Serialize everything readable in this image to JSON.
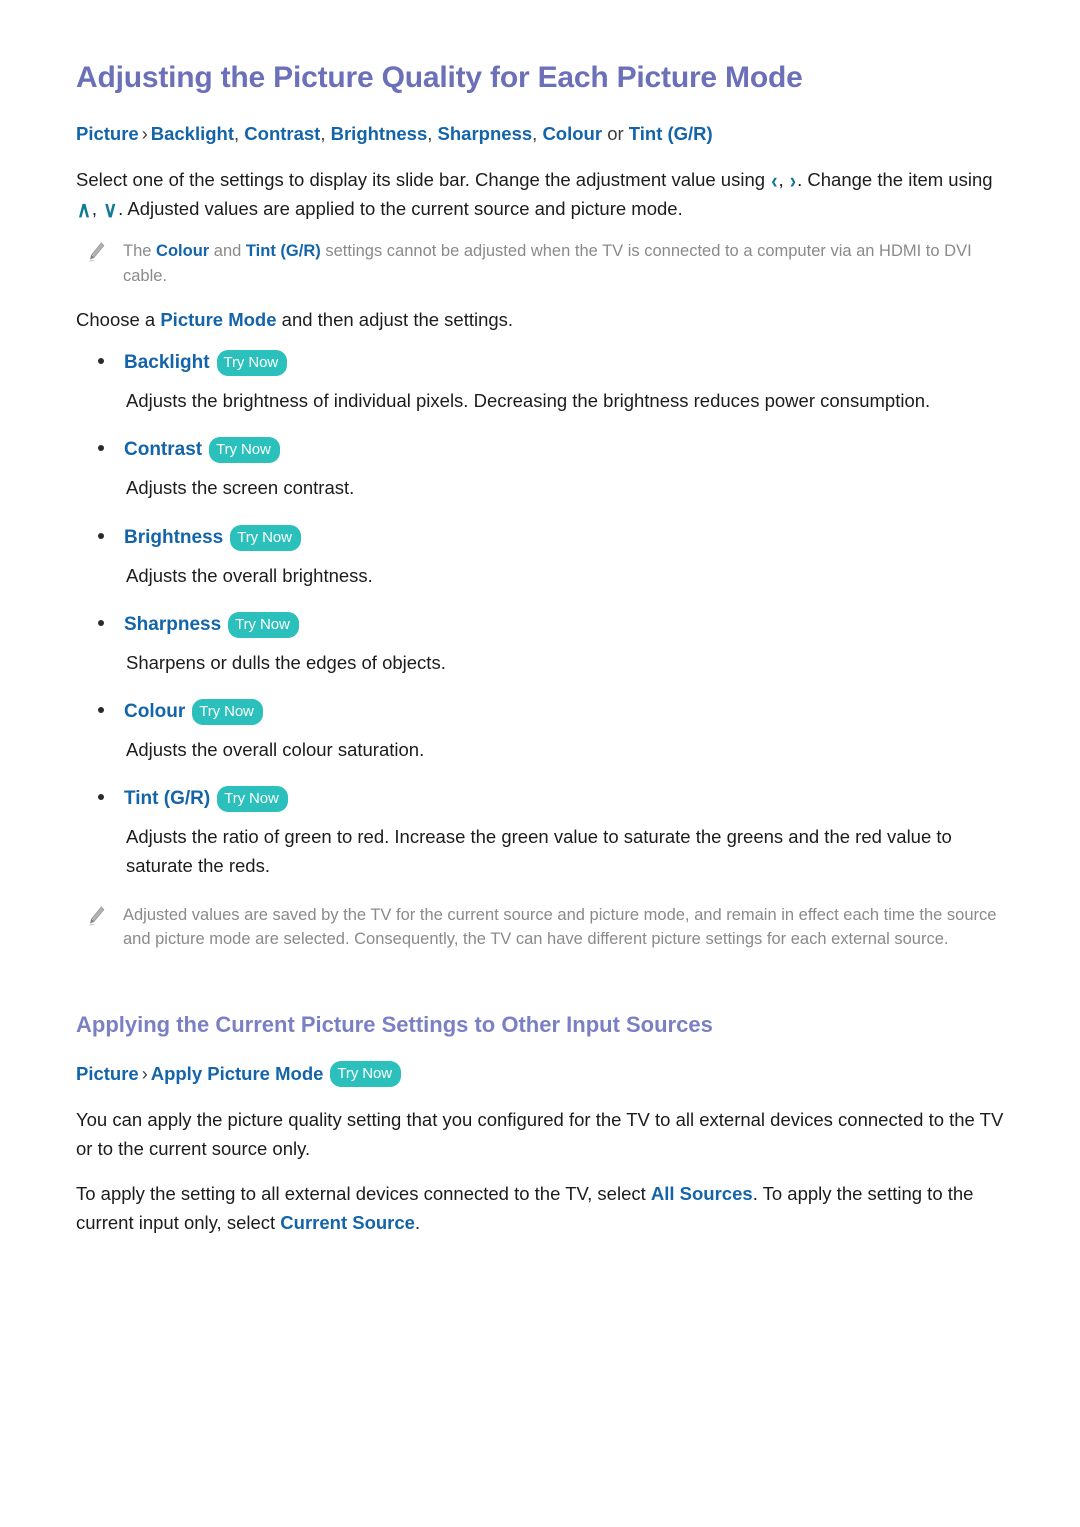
{
  "document": {
    "title": "Adjusting the Picture Quality for Each Picture Mode",
    "breadcrumb_1": {
      "root": "Picture",
      "separator": "›",
      "items": [
        "Backlight",
        "Contrast",
        "Brightness",
        "Sharpness",
        "Colour"
      ],
      "conjunction": "or",
      "last_item": "Tint (G/R)",
      "comma": ", "
    },
    "intro_paragraph": {
      "part_1": "Select one of the settings to display its slide bar. Change the adjustment value using ",
      "icon_left": "‹",
      "icon_right": "›",
      "part_2": ". Change the item using ",
      "icon_up": "∧",
      "icon_down": "∨",
      "part_3": ". Adjusted values are applied to the current source and picture mode."
    },
    "note_1": {
      "icon": "pencil-icon",
      "text_1": "The ",
      "link_1": "Colour",
      "text_2": " and ",
      "link_2": "Tint (G/R)",
      "text_3": " settings cannot be adjusted when the TV is connected to a computer via an HDMI to DVI cable."
    },
    "choose_paragraph": {
      "part_1": "Choose a ",
      "link": "Picture Mode",
      "part_2": " and then adjust the settings."
    },
    "settings": [
      {
        "label": "Backlight",
        "badge": "Try Now",
        "description": "Adjusts the brightness of individual pixels. Decreasing the brightness reduces power consumption."
      },
      {
        "label": "Contrast",
        "badge": "Try Now",
        "description": "Adjusts the screen contrast."
      },
      {
        "label": "Brightness",
        "badge": "Try Now",
        "description": "Adjusts the overall brightness."
      },
      {
        "label": "Sharpness",
        "badge": "Try Now",
        "description": "Sharpens or dulls the edges of objects."
      },
      {
        "label": "Colour",
        "badge": "Try Now",
        "description": "Adjusts the overall colour saturation."
      },
      {
        "label": "Tint (G/R)",
        "badge": "Try Now",
        "description": "Adjusts the ratio of green to red. Increase the green value to saturate the greens and the red value to saturate the reds."
      }
    ],
    "note_2": {
      "icon": "pencil-icon",
      "text": "Adjusted values are saved by the TV for the current source and picture mode, and remain in effect each time the source and picture mode are selected. Consequently, the TV can have different picture settings for each external source."
    },
    "section_2": {
      "title": "Applying the Current Picture Settings to Other Input Sources",
      "breadcrumb": {
        "root": "Picture",
        "separator": "›",
        "item": "Apply Picture Mode",
        "badge": "Try Now"
      },
      "paragraph_1": "You can apply the picture quality setting that you configured for the TV to all external devices connected to the TV or to the current source only.",
      "paragraph_2": {
        "part_1": "To apply the setting to all external devices connected to the TV, select ",
        "link_1": "All Sources",
        "part_2": ". To apply the setting to the current input only, select ",
        "link_2": "Current Source",
        "part_3": "."
      }
    }
  },
  "colors": {
    "heading_purple": "#6b70b8",
    "link_blue": "#1464aa",
    "badge_teal": "#2bc0bb",
    "chevron_teal": "#0f7b94",
    "note_gray": "#8a8a8a",
    "body_text": "#1c1c1c"
  }
}
